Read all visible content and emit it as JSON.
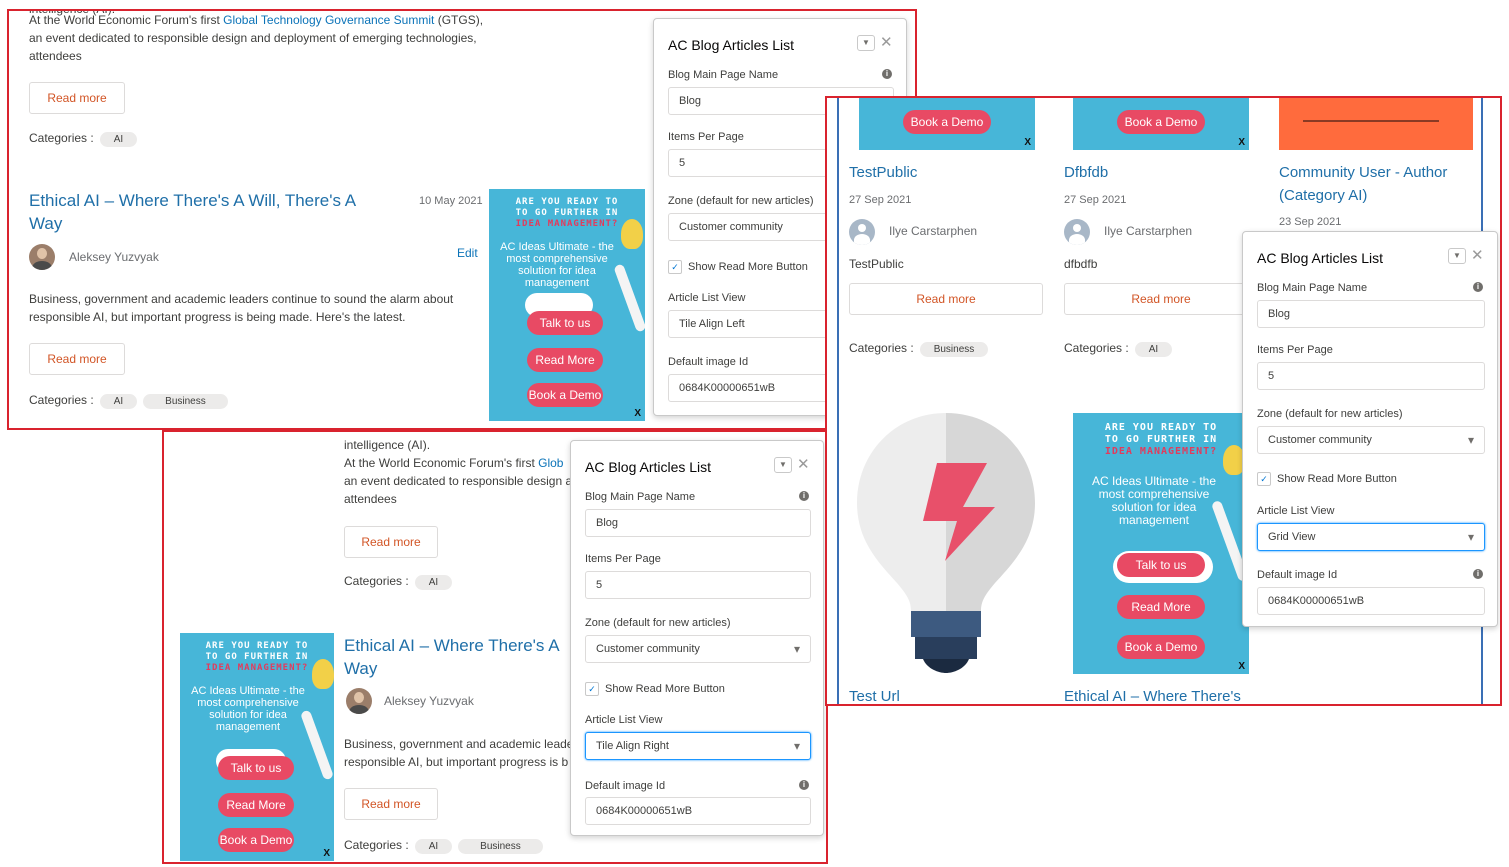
{
  "frame1": {
    "intro_line0": "intelligence (AI).",
    "intro_line1_prefix": "At the World Economic Forum's first ",
    "intro_line1_link": "Global Technology Governance Summit",
    "intro_line1_suffix": " (GTGS),",
    "intro_line2": "an event dedicated to responsible design and deployment of emerging technologies,",
    "intro_line3": "attendees",
    "read_more": "Read more",
    "categories_label": "Categories :",
    "cat1": "AI",
    "article_title_line1": "Ethical AI – Where There's A Will, There's A",
    "article_title_line2": "Way",
    "date": "10 May 2021",
    "author": "Aleksey Yuzvyak",
    "edit": "Edit",
    "body_line1": "Business, government and academic leaders continue to sound the alarm about",
    "body_line2": "responsible AI, but important progress is being made. Here's the latest.",
    "read_more2": "Read more",
    "cat2a": "AI",
    "cat2b": "Business"
  },
  "ad": {
    "line1": "ARE YOU READY TO",
    "line2": "TO GO FURTHER IN",
    "line3": "IDEA MANAGEMENT?",
    "desc": "AC Ideas Ultimate - the most comprehensive solution for idea management",
    "btn1": "Talk to us",
    "btn2": "Read More",
    "btn3": "Book a Demo",
    "close": "X"
  },
  "panel1": {
    "title": "AC Blog Articles List",
    "lbl_main": "Blog Main Page Name",
    "val_main": "Blog",
    "lbl_items": "Items Per Page",
    "val_items": "5",
    "lbl_zone": "Zone (default for new articles)",
    "val_zone": "Customer community",
    "chk_label": "Show Read More Button",
    "lbl_view": "Article List View",
    "val_view": "Tile Align Left",
    "lbl_img": "Default image Id",
    "val_img": "0684K00000651wB"
  },
  "frame2": {
    "intro_line0": "intelligence (AI).",
    "intro_line1_prefix": "At the World Economic Forum's first ",
    "intro_line1_link": "Glob",
    "intro_line2": "an event dedicated to responsible design a",
    "intro_line3": "attendees",
    "read_more": "Read more",
    "categories_label": "Categories :",
    "cat1": "AI",
    "article_title_line1": "Ethical AI – Where There's A",
    "article_title_line2": "Way",
    "author": "Aleksey Yuzvyak",
    "body_line1": "Business, government and academic leader",
    "body_line2": "responsible AI, but important progress is b",
    "read_more2": "Read more",
    "cat2a": "AI",
    "cat2b": "Business"
  },
  "panel2": {
    "title": "AC Blog Articles List",
    "lbl_main": "Blog Main Page Name",
    "val_main": "Blog",
    "lbl_items": "Items Per Page",
    "val_items": "5",
    "lbl_zone": "Zone (default for new articles)",
    "val_zone": "Customer community",
    "chk_label": "Show Read More Button",
    "lbl_view": "Article List View",
    "val_view": "Tile Align Right",
    "lbl_img": "Default image Id",
    "val_img": "0684K00000651wB"
  },
  "frame3": {
    "book_demo": "Book a Demo",
    "close": "X",
    "card1_title": "TestPublic",
    "card1_date": "27 Sep 2021",
    "card1_author": "Ilye Carstarphen",
    "card1_body": "TestPublic",
    "card1_read": "Read more",
    "card1_cat_label": "Categories :",
    "card1_cat": "Business",
    "card2_title": "Dfbfdb",
    "card2_date": "27 Sep 2021",
    "card2_author": "Ilye Carstarphen",
    "card2_body": "dfbdfb",
    "card2_read": "Read more",
    "card2_cat_label": "Categories :",
    "card2_cat": "AI",
    "card3_title_line1": "Community User - Author",
    "card3_title_line2": "(Category AI)",
    "card3_date": "23 Sep 2021",
    "bottom1_title": "Test Url",
    "bottom2_title": "Ethical AI – Where There's"
  },
  "panel3": {
    "title": "AC Blog Articles List",
    "lbl_main": "Blog Main Page Name",
    "val_main": "Blog",
    "lbl_items": "Items Per Page",
    "val_items": "5",
    "lbl_zone": "Zone (default for new articles)",
    "val_zone": "Customer community",
    "chk_label": "Show Read More Button",
    "lbl_view": "Article List View",
    "val_view": "Grid View",
    "lbl_img": "Default image Id",
    "val_img": "0684K00000651wB"
  },
  "colors": {
    "frame_border": "#d9232e",
    "link": "#0b73b8",
    "accent_button": "#e84a64",
    "banner": "#47b6d8"
  }
}
